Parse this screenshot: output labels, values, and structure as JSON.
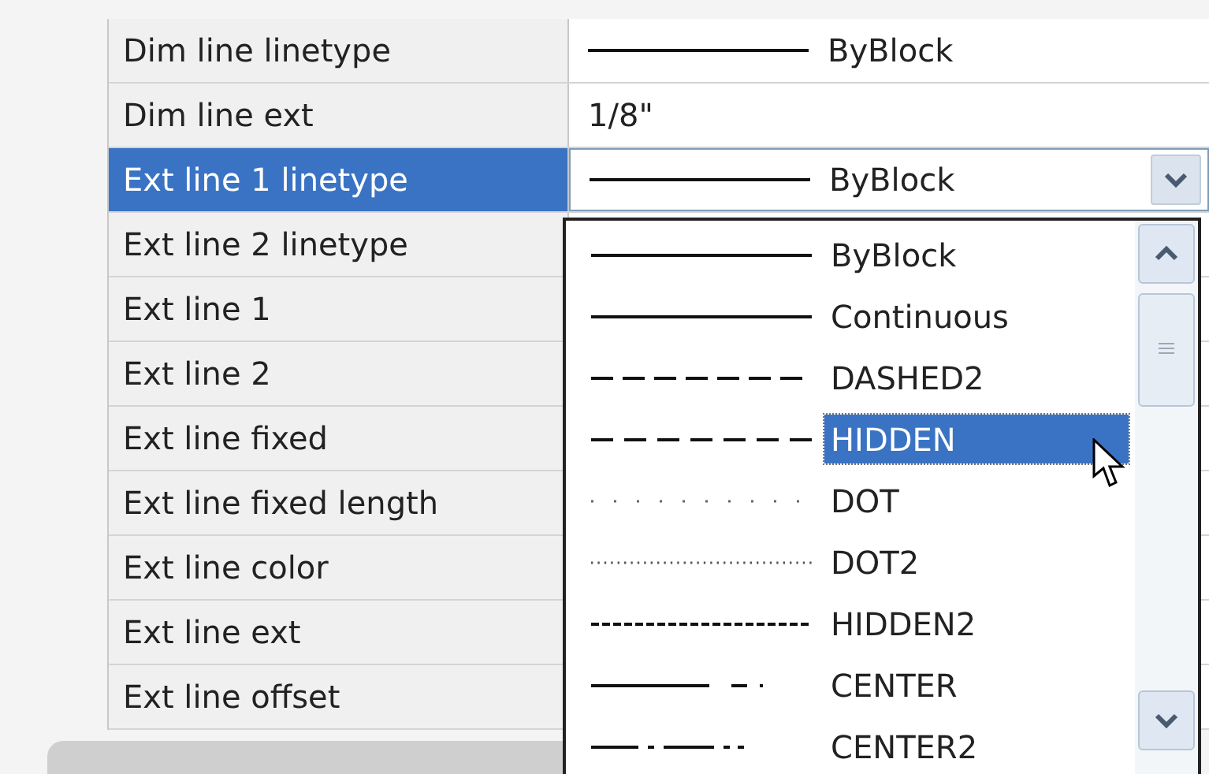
{
  "properties": [
    {
      "name": "Dim line linetype",
      "selected": false,
      "value": {
        "kind": "solid",
        "text": "ByBlock"
      }
    },
    {
      "name": "Dim line ext",
      "selected": false,
      "value": {
        "kind": "text",
        "text": "1/8\""
      }
    },
    {
      "name": "Ext line 1 linetype",
      "selected": true,
      "value": {
        "kind": "solid",
        "text": "ByBlock"
      }
    },
    {
      "name": "Ext line 2 linetype",
      "selected": false
    },
    {
      "name": "Ext line 1",
      "selected": false
    },
    {
      "name": "Ext line 2",
      "selected": false
    },
    {
      "name": "Ext line fixed",
      "selected": false
    },
    {
      "name": "Ext line fixed length",
      "selected": false
    },
    {
      "name": "Ext line color",
      "selected": false
    },
    {
      "name": "Ext line ext",
      "selected": false
    },
    {
      "name": "Ext line offset",
      "selected": false
    }
  ],
  "linetype_dropdown": {
    "items": [
      {
        "label": "ByBlock",
        "kind": "solid",
        "selected": false
      },
      {
        "label": "Continuous",
        "kind": "solid",
        "selected": false
      },
      {
        "label": "DASHED2",
        "kind": "dashed",
        "selected": false
      },
      {
        "label": "HIDDEN",
        "kind": "hidden",
        "selected": true
      },
      {
        "label": "DOT",
        "kind": "dot",
        "selected": false
      },
      {
        "label": "DOT2",
        "kind": "dot2",
        "selected": false
      },
      {
        "label": "HIDDEN2",
        "kind": "hidden2",
        "selected": false
      },
      {
        "label": "CENTER",
        "kind": "center",
        "selected": false
      },
      {
        "label": "CENTER2",
        "kind": "center2",
        "selected": false
      }
    ]
  }
}
